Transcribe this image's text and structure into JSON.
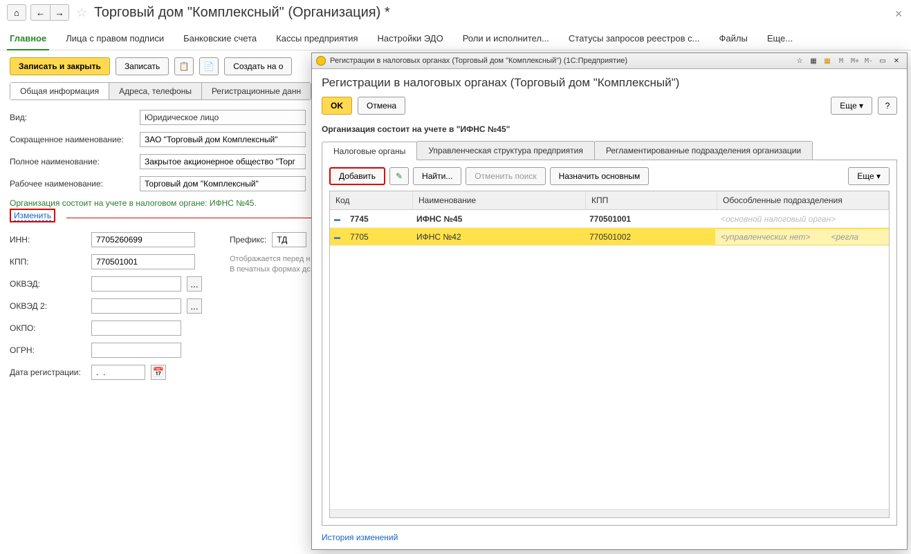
{
  "page_title": "Торговый дом \"Комплексный\" (Организация) *",
  "tabs": {
    "main": "Главное",
    "signers": "Лица с правом подписи",
    "bank": "Банковские счета",
    "cash": "Кассы предприятия",
    "edo": "Настройки ЭДО",
    "roles": "Роли и исполнител...",
    "statuses": "Статусы запросов реестров с...",
    "files": "Файлы",
    "more": "Еще..."
  },
  "toolbar": {
    "save_close": "Записать и закрыть",
    "save": "Записать",
    "create_based": "Создать на о"
  },
  "sub_tabs": {
    "general": "Общая информация",
    "addresses": "Адреса, телефоны",
    "regdata": "Регистрационные данн"
  },
  "form": {
    "kind_label": "Вид:",
    "kind_value": "Юридическое лицо",
    "short_label": "Сокращенное наименование:",
    "short_value": "ЗАО \"Торговый дом Комплексный\"",
    "full_label": "Полное наименование:",
    "full_value": "Закрытое акционерное общество \"Торг",
    "work_label": "Рабочее наименование:",
    "work_value": "Торговый дом \"Комплексный\"",
    "tax_info": "Организация состоит на учете в налоговом органе: ИФНС №45.",
    "change": "Изменить",
    "inn_label": "ИНН:",
    "inn_value": "7705260699",
    "kpp_label": "КПП:",
    "kpp_value": "770501001",
    "okved_label": "ОКВЭД:",
    "okved2_label": "ОКВЭД 2:",
    "okpo_label": "ОКПО:",
    "ogrn_label": "ОГРН:",
    "regdate_label": "Дата регистрации:",
    "regdate_value": ".  .",
    "prefix_label": "Префикс:",
    "prefix_value": "ТД",
    "prefix_note1": "Отображается перед н",
    "prefix_note2": "В печатных формах дс"
  },
  "modal": {
    "title_bar": "Регистрации в налоговых органах (Торговый дом \"Комплексный\")  (1С:Предприятие)",
    "calc": [
      "M",
      "M+",
      "M-"
    ],
    "heading": "Регистрации в налоговых органах (Торговый дом \"Комплексный\")",
    "ok": "OK",
    "cancel": "Отмена",
    "more": "Еще",
    "help": "?",
    "org_line": "Организация состоит на учете в \"ИФНС №45\"",
    "tabs": {
      "tax": "Налоговые органы",
      "mgmt": "Управленческая структура предприятия",
      "regdiv": "Регламентированные подразделения организации"
    },
    "grid_toolbar": {
      "add": "Добавить",
      "find": "Найти...",
      "cancel_search": "Отменить поиск",
      "set_primary": "Назначить основным",
      "more": "Еще"
    },
    "grid": {
      "headers": {
        "code": "Код",
        "name": "Наименование",
        "kpp": "КПП",
        "div": "Обособленные подразделения"
      },
      "rows": [
        {
          "code": "7745",
          "name": "ИФНС №45",
          "kpp": "770501001",
          "div": "<основной налоговый орган>",
          "sel": false
        },
        {
          "code": "7705",
          "name": "ИФНС №42",
          "kpp": "770501002",
          "div": "<управленческих нет>",
          "regl": "<регла",
          "sel": true
        }
      ]
    },
    "history": "История изменений"
  }
}
